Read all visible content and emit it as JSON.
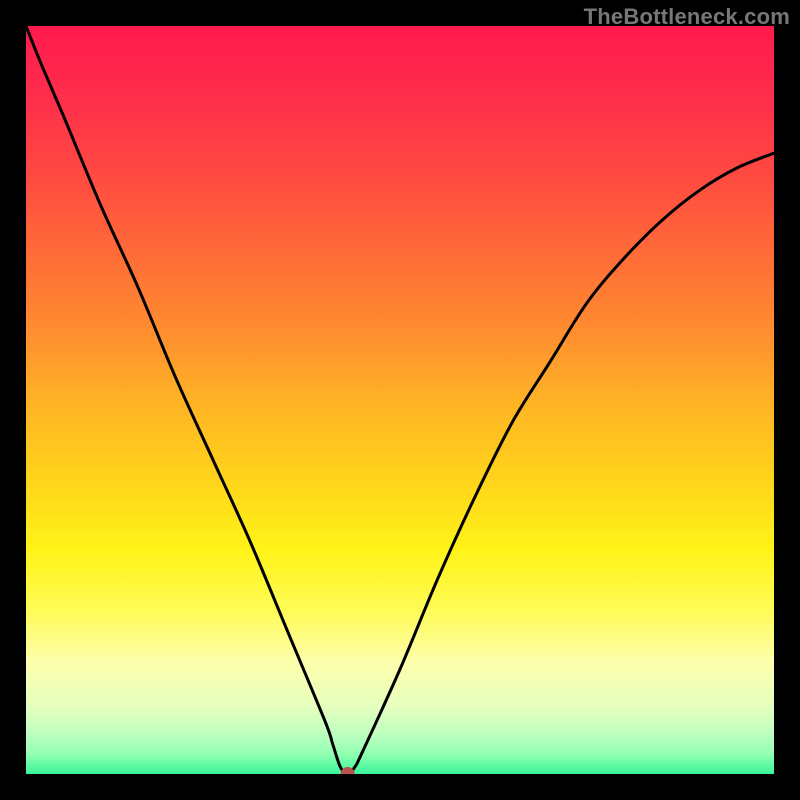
{
  "watermark": "TheBottleneck.com",
  "colors": {
    "frame": "#000000",
    "curve_stroke": "#000000",
    "marker_fill": "#b7524e",
    "gradient_stops": [
      {
        "offset": 0.0,
        "color": "#ff1a4d"
      },
      {
        "offset": 0.1,
        "color": "#ff2f4b"
      },
      {
        "offset": 0.2,
        "color": "#ff4a41"
      },
      {
        "offset": 0.3,
        "color": "#ff6a38"
      },
      {
        "offset": 0.4,
        "color": "#ff8a30"
      },
      {
        "offset": 0.5,
        "color": "#ffb225"
      },
      {
        "offset": 0.6,
        "color": "#ffd21b"
      },
      {
        "offset": 0.7,
        "color": "#fff318"
      },
      {
        "offset": 0.78,
        "color": "#fffb55"
      },
      {
        "offset": 0.85,
        "color": "#fdffac"
      },
      {
        "offset": 0.91,
        "color": "#e6ffbf"
      },
      {
        "offset": 0.95,
        "color": "#b9ffbf"
      },
      {
        "offset": 0.975,
        "color": "#8dffb0"
      },
      {
        "offset": 1.0,
        "color": "#38f59a"
      }
    ]
  },
  "chart_data": {
    "type": "line",
    "title": "",
    "xlabel": "",
    "ylabel": "",
    "xlim": [
      0,
      100
    ],
    "ylim": [
      0,
      100
    ],
    "grid": false,
    "x": [
      0,
      2,
      5,
      10,
      15,
      20,
      25,
      30,
      35,
      40,
      41,
      42,
      43,
      44,
      45,
      50,
      55,
      60,
      65,
      70,
      75,
      80,
      85,
      90,
      95,
      100
    ],
    "values": [
      100,
      95,
      88,
      76,
      65,
      53,
      42,
      31,
      19,
      7,
      4,
      1,
      0,
      1,
      3,
      14,
      26,
      37,
      47,
      55,
      63,
      69,
      74,
      78,
      81,
      83
    ],
    "marker": {
      "x": 43,
      "y": 0
    }
  }
}
